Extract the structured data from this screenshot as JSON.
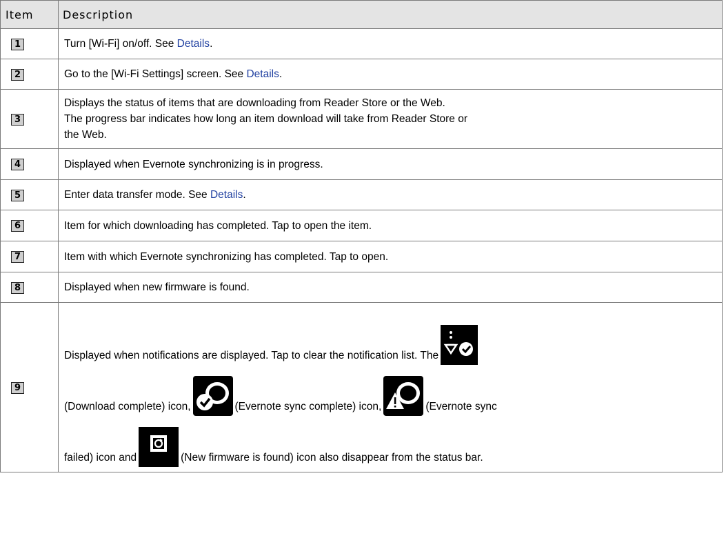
{
  "table": {
    "header": {
      "item": "Item",
      "description": "Description"
    },
    "rows": [
      {
        "num": "1",
        "pre": "Turn [Wi-Fi] on/off. See ",
        "link": "Details",
        "post": "."
      },
      {
        "num": "2",
        "pre": "Go to the [Wi-Fi Settings] screen. See ",
        "link": "Details",
        "post": "."
      },
      {
        "num": "3",
        "line1": "Displays the status of items that are downloading from Reader Store or the Web.",
        "line2": "The progress bar indicates how long an item download will take from Reader Store or",
        "line3": "the Web."
      },
      {
        "num": "4",
        "text": "Displayed when Evernote synchronizing is in progress."
      },
      {
        "num": "5",
        "pre": "Enter data transfer mode. See ",
        "link": "Details",
        "post": "."
      },
      {
        "num": "6",
        "text": "Item for which downloading has completed. Tap to open the item."
      },
      {
        "num": "7",
        "text": "Item with which Evernote synchronizing has completed. Tap to open."
      },
      {
        "num": "8",
        "text": "Displayed when new firmware is found."
      },
      {
        "num": "9",
        "t1": "Displayed when notifications are displayed. Tap to clear the notification list. The",
        "t2": "(Download complete) icon,",
        "t3": "(Evernote sync complete) icon,",
        "t4": "(Evernote sync",
        "t5": "failed) icon and",
        "t6": "(New firmware is found) icon also disappear from the status bar.",
        "icons": [
          "notification-icon",
          "download-complete-icon",
          "evernote-sync-complete-icon",
          "evernote-sync-failed-icon",
          "new-firmware-icon"
        ]
      }
    ]
  },
  "colors": {
    "header_bg": "#e4e4e4",
    "link": "#1f3fa0",
    "border": "#7a7a7a",
    "badge_bg": "#cfcfcf"
  }
}
